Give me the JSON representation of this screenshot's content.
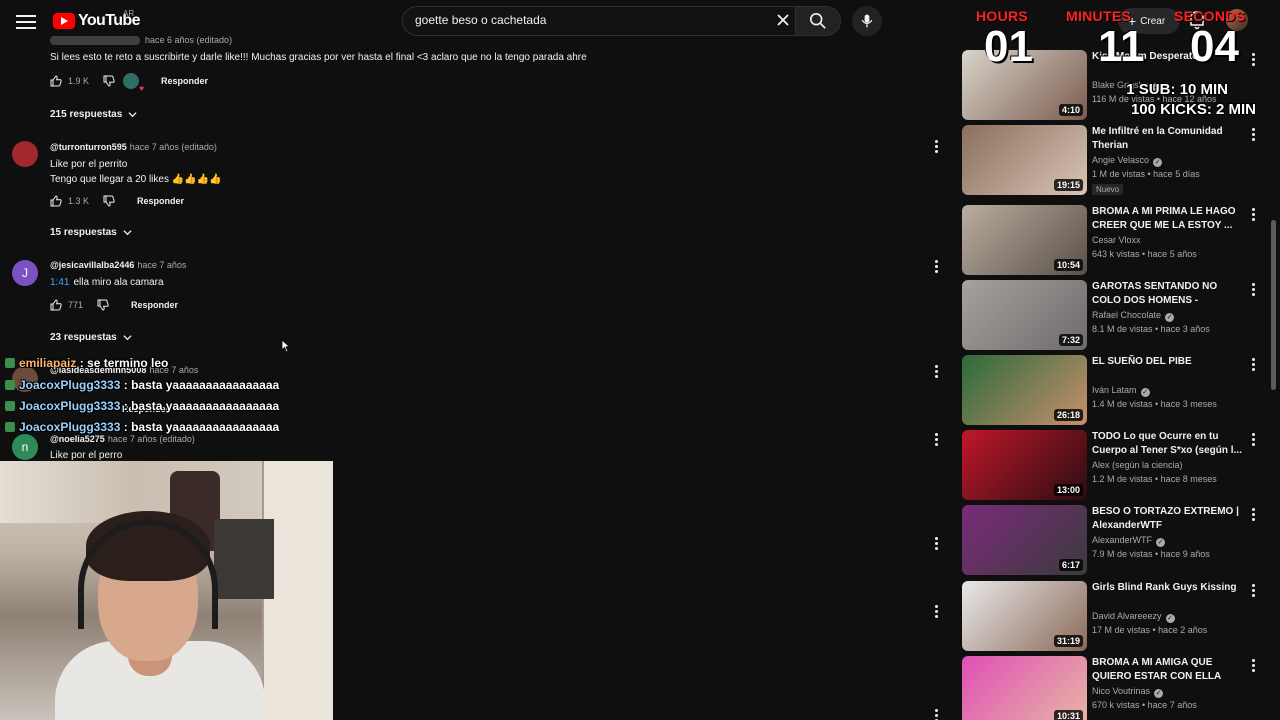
{
  "header": {
    "logo_text": "YouTube",
    "region": "AR",
    "search_value": "goette beso o cachetada",
    "create_label": "Crear"
  },
  "comments": [
    {
      "handle": "",
      "time": "hace 6 años (editado)",
      "text": "Si lees esto te reto a suscribirte y darle like!!! Muchas gracias por ver hasta el final <3 aclaro que no la tengo parada ahre",
      "likes": "1.9 K",
      "reply_label": "Responder",
      "replies": "215 respuestas"
    },
    {
      "handle": "@turronturron595",
      "time": "hace 7 años (editado)",
      "text_lines": [
        "Like por el perrito",
        "Tengo que llegar a 20 likes 👍👍👍👍"
      ],
      "likes": "1.3 K",
      "reply_label": "Responder",
      "replies": "15 respuestas",
      "avatar_color": "#a3282e"
    },
    {
      "handle": "@jesicavillalba2446",
      "time": "hace 7 años",
      "timestamp": "1:41",
      "text": "ella miro ala camara",
      "likes": "771",
      "reply_label": "Responder",
      "replies": "23 respuestas",
      "avatar_letter": "J",
      "avatar_color": "#7a52c4"
    },
    {
      "handle": "@lasideasdeminn5008",
      "time": "hace 7 años",
      "reply_label": "Responder"
    },
    {
      "handle": "@noelia5275",
      "time": "hace 7 años (editado)",
      "text": "Like por el perro",
      "avatar_letter": "n",
      "avatar_color": "#2e8b57"
    }
  ],
  "chat": [
    {
      "user": "emiliapaiz",
      "message": "se termino leo"
    },
    {
      "user": "JoacoxPlugg3333",
      "message": "basta yaaaaaaaaaaaaaaaa"
    },
    {
      "user": "JoacoxPlugg3333",
      "message": "basta yaaaaaaaaaaaaaaaa"
    },
    {
      "user": "JoacoxPlugg3333",
      "message": "basta yaaaaaaaaaaaaaaaa"
    }
  ],
  "timer": {
    "hours_label": "HOURS",
    "minutes_label": "MINUTES",
    "seconds_label": "SECONDS",
    "hours": "01",
    "minutes": "11",
    "seconds": "04",
    "rule_1": "1 SUB: 10 MIN",
    "rule_2": "100 KICKS: 2 MIN"
  },
  "sidebar": [
    {
      "title": "Kiss Me I'm Desperate",
      "channel": "Blake Grigsby",
      "verified": true,
      "meta": "116 M de vistas • hace 12 años",
      "duration": "4:10",
      "colors": [
        "#d9d4cb",
        "#7b5c4e"
      ]
    },
    {
      "title": "Me Infiltré en la Comunidad Therian",
      "channel": "Angie Velasco",
      "verified": true,
      "meta": "1 M de vistas • hace 5 días",
      "duration": "19:15",
      "badge": "Nuevo",
      "colors": [
        "#8a6f5d",
        "#d9c4b5"
      ]
    },
    {
      "title": "BROMA A MI PRIMA LE HAGO CREER QUE ME LA ESTOY ...",
      "channel": "Cesar Vloxx",
      "verified": false,
      "meta": "643 k vistas • hace 5 años",
      "duration": "10:54",
      "colors": [
        "#b9aea0",
        "#5b5048"
      ]
    },
    {
      "title": "GAROTAS SENTANDO NO COLO DOS HOMENS - Pegadinha",
      "channel": "Rafael Chocolate",
      "verified": true,
      "meta": "8.1 M de vistas • hace 3 años",
      "duration": "7:32",
      "colors": [
        "#a7a29e",
        "#6e6a6b"
      ]
    },
    {
      "title": "EL SUEÑO DEL PIBE",
      "channel": "Iván Latam",
      "verified": true,
      "meta": "1.4 M de vistas • hace 3 meses",
      "duration": "26:18",
      "colors": [
        "#2b6b3a",
        "#c88f6d"
      ]
    },
    {
      "title": "TODO Lo que Ocurre en tu Cuerpo al Tener S*xo (según l...",
      "channel": "Alex (según la ciencia)",
      "verified": false,
      "meta": "1.2 M de vistas • hace 8 meses",
      "duration": "13:00",
      "colors": [
        "#c0182a",
        "#2a0c10"
      ]
    },
    {
      "title": "BESO O TORTAZO EXTREMO | AlexanderWTF",
      "channel": "AlexanderWTF",
      "verified": true,
      "meta": "7.9 M de vistas • hace 9 años",
      "duration": "6:17",
      "colors": [
        "#7a2b7a",
        "#3b3b3b"
      ]
    },
    {
      "title": "Girls Blind Rank Guys Kissing",
      "channel": "David Alvareeezy",
      "verified": true,
      "meta": "17 M de vistas • hace 2 años",
      "duration": "31:19",
      "colors": [
        "#e9e9e9",
        "#8a6a58"
      ]
    },
    {
      "title": "BROMA A MI AMIGA QUE QUIERO ESTAR CON ELLA",
      "channel": "Nico Voutrinas",
      "verified": true,
      "meta": "670 k vistas • hace 7 años",
      "duration": "10:31",
      "colors": [
        "#e04fb7",
        "#e7b7a2"
      ]
    }
  ]
}
